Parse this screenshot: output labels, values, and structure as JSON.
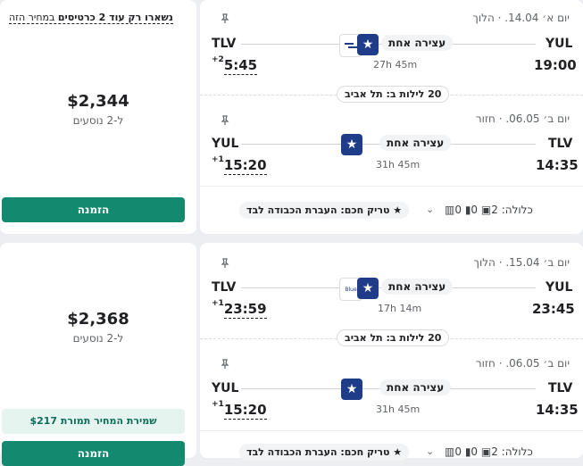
{
  "results": [
    {
      "outbound": {
        "dir_label": "הלוך",
        "date": "יום א׳ 14.04.",
        "from_code": "YUL",
        "from_time": "19:00",
        "to_code": "TLV",
        "to_time": "5:45",
        "day_offset": "+2",
        "stops": "עצירה אחת",
        "duration": "27h 45m"
      },
      "nights": "20 לילות ב: תל אביב",
      "inbound": {
        "dir_label": "חזור",
        "date": "יום ב׳ 06.05.",
        "from_code": "TLV",
        "from_time": "14:35",
        "to_code": "YUL",
        "to_time": "15:20",
        "day_offset": "+1",
        "stops": "עצירה אחת",
        "duration": "31h 45m"
      },
      "baggage": {
        "label": "כלולה:",
        "carry": "2",
        "personal": "0",
        "checked": "0"
      },
      "fare_tag": "טריק חכם: העברת הכבודה לבד",
      "price": "$2,344",
      "pax": "ל-2 נוסעים",
      "warning_bold": "נשארו רק עוד 2 כרטיסים",
      "warning_rest": " במחיר הזה",
      "book_label": "הזמנה"
    },
    {
      "outbound": {
        "dir_label": "הלוך",
        "date": "יום ב׳ 15.04.",
        "from_code": "YUL",
        "from_time": "23:45",
        "to_code": "TLV",
        "to_time": "23:59",
        "day_offset": "+1",
        "stops": "עצירה אחת",
        "duration": "17h 14m"
      },
      "nights": "20 לילות ב: תל אביב",
      "inbound": {
        "dir_label": "חזור",
        "date": "יום ב׳ 06.05.",
        "from_code": "TLV",
        "from_time": "14:35",
        "to_code": "YUL",
        "to_time": "15:20",
        "day_offset": "+1",
        "stops": "עצירה אחת",
        "duration": "31h 45m"
      },
      "baggage": {
        "label": "כלולה:",
        "carry": "2",
        "personal": "0",
        "checked": "0"
      },
      "fare_tag": "טריק חכם: העברת הכבודה לבד",
      "price": "$2,368",
      "pax": "ל-2 נוסעים",
      "savings": "שמירת המחיר תמורת $217",
      "book_label": "הזמנה"
    }
  ],
  "colors": {
    "accent": "#138a6f",
    "airline_blue": "#1f3c88"
  }
}
